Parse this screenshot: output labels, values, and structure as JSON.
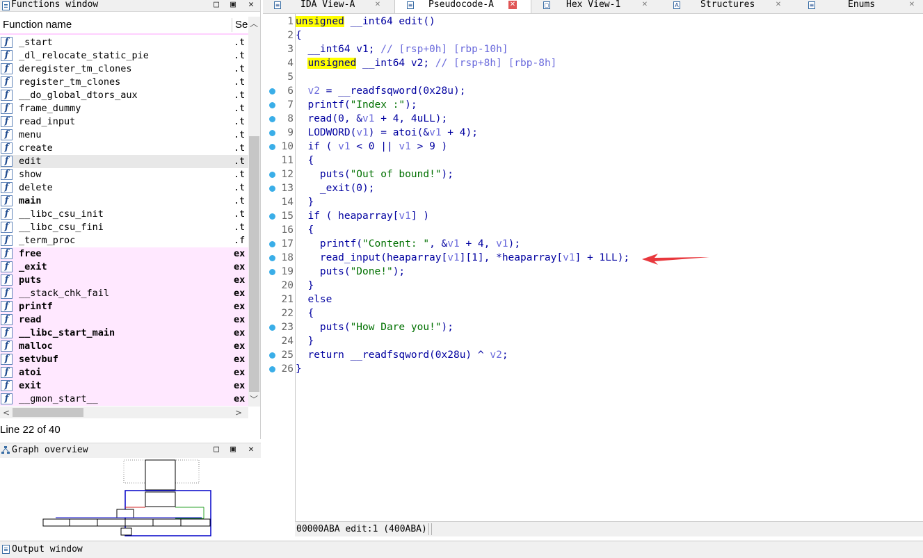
{
  "functions_window": {
    "title": "Functions window",
    "header_name": "Function name",
    "header_segment": "Se",
    "status": "Line 22 of 40",
    "rows": [
      {
        "name": "_start",
        "seg": ".t",
        "imported": false
      },
      {
        "name": "_dl_relocate_static_pie",
        "seg": ".t",
        "imported": false
      },
      {
        "name": "deregister_tm_clones",
        "seg": ".t",
        "imported": false
      },
      {
        "name": "register_tm_clones",
        "seg": ".t",
        "imported": false
      },
      {
        "name": "__do_global_dtors_aux",
        "seg": ".t",
        "imported": false
      },
      {
        "name": "frame_dummy",
        "seg": ".t",
        "imported": false
      },
      {
        "name": "read_input",
        "seg": ".t",
        "imported": false
      },
      {
        "name": "menu",
        "seg": ".t",
        "imported": false
      },
      {
        "name": "create",
        "seg": ".t",
        "imported": false
      },
      {
        "name": "edit",
        "seg": ".t",
        "imported": false,
        "selected": true
      },
      {
        "name": "show",
        "seg": ".t",
        "imported": false
      },
      {
        "name": "delete",
        "seg": ".t",
        "imported": false
      },
      {
        "name": "main",
        "seg": ".t",
        "imported": false,
        "bold": true
      },
      {
        "name": "__libc_csu_init",
        "seg": ".t",
        "imported": false
      },
      {
        "name": "__libc_csu_fini",
        "seg": ".t",
        "imported": false
      },
      {
        "name": "_term_proc",
        "seg": ".f",
        "imported": false
      },
      {
        "name": "free",
        "seg": "ex",
        "imported": true
      },
      {
        "name": "_exit",
        "seg": "ex",
        "imported": true
      },
      {
        "name": "puts",
        "seg": "ex",
        "imported": true
      },
      {
        "name": "__stack_chk_fail",
        "seg": "ex",
        "imported": true,
        "normal": true
      },
      {
        "name": "printf",
        "seg": "ex",
        "imported": true
      },
      {
        "name": "read",
        "seg": "ex",
        "imported": true
      },
      {
        "name": "__libc_start_main",
        "seg": "ex",
        "imported": true
      },
      {
        "name": "malloc",
        "seg": "ex",
        "imported": true
      },
      {
        "name": "setvbuf",
        "seg": "ex",
        "imported": true
      },
      {
        "name": "atoi",
        "seg": "ex",
        "imported": true
      },
      {
        "name": "exit",
        "seg": "ex",
        "imported": true
      },
      {
        "name": "__gmon_start__",
        "seg": "ex",
        "imported": true,
        "normal": true
      }
    ]
  },
  "graph_overview": {
    "title": "Graph overview"
  },
  "tabs": [
    {
      "label": "IDA View-A",
      "icon": "ida-view-icon",
      "active": false
    },
    {
      "label": "Pseudocode-A",
      "icon": "pseudocode-icon",
      "active": true
    },
    {
      "label": "Hex View-1",
      "icon": "hex-view-icon",
      "active": false
    },
    {
      "label": "Structures",
      "icon": "structures-icon",
      "active": false
    },
    {
      "label": "Enums",
      "icon": "enums-icon",
      "active": false
    }
  ],
  "pseudocode": {
    "lines": [
      {
        "n": "1",
        "dot": false,
        "html": "<span class='kwhl'>unsigned</span> __int64 edit()"
      },
      {
        "n": "2",
        "dot": false,
        "html": "{"
      },
      {
        "n": "3",
        "dot": false,
        "html": "  __int64 v1; <span class='cm'>// [rsp+0h] [rbp-10h]</span>"
      },
      {
        "n": "4",
        "dot": false,
        "html": "  <span class='kwhl'>unsigned</span> __int64 v2; <span class='cm'>// [rsp+8h] [rbp-8h]</span>"
      },
      {
        "n": "5",
        "dot": false,
        "html": ""
      },
      {
        "n": "6",
        "dot": true,
        "html": "  <span class='gv'>v2</span> = __readfsqword(0x28u);"
      },
      {
        "n": "7",
        "dot": true,
        "html": "  printf(<span class='str'>\"Index :\"</span>);"
      },
      {
        "n": "8",
        "dot": true,
        "html": "  read(0, &amp;<span class='gv'>v1</span> + 4, 4uLL);"
      },
      {
        "n": "9",
        "dot": true,
        "html": "  LODWORD(<span class='gv'>v1</span>) = atoi(&amp;<span class='gv'>v1</span> + 4);"
      },
      {
        "n": "10",
        "dot": true,
        "html": "  if ( <span class='gv'>v1</span> &lt; 0 || <span class='gv'>v1</span> &gt; 9 )"
      },
      {
        "n": "11",
        "dot": false,
        "html": "  {"
      },
      {
        "n": "12",
        "dot": true,
        "html": "    puts(<span class='str'>\"Out of bound!\"</span>);"
      },
      {
        "n": "13",
        "dot": true,
        "html": "    _exit(0);"
      },
      {
        "n": "14",
        "dot": false,
        "html": "  }"
      },
      {
        "n": "15",
        "dot": true,
        "html": "  if ( heaparray[<span class='gv'>v1</span>] )"
      },
      {
        "n": "16",
        "dot": false,
        "html": "  {"
      },
      {
        "n": "17",
        "dot": true,
        "html": "    printf(<span class='str'>\"Content: \"</span>, &amp;<span class='gv'>v1</span> + 4, <span class='gv'>v1</span>);"
      },
      {
        "n": "18",
        "dot": true,
        "html": "    read_input(heaparray[<span class='gv'>v1</span>][1], *heaparray[<span class='gv'>v1</span>] + 1LL);"
      },
      {
        "n": "19",
        "dot": true,
        "html": "    puts(<span class='str'>\"Done!\"</span>);"
      },
      {
        "n": "20",
        "dot": false,
        "html": "  }"
      },
      {
        "n": "21",
        "dot": false,
        "html": "  else"
      },
      {
        "n": "22",
        "dot": false,
        "html": "  {"
      },
      {
        "n": "23",
        "dot": true,
        "html": "    puts(<span class='str'>\"How Dare you!\"</span>);"
      },
      {
        "n": "24",
        "dot": false,
        "html": "  }"
      },
      {
        "n": "25",
        "dot": true,
        "html": "  return __readfsqword(0x28u) ^ <span class='gv'>v2</span>;"
      },
      {
        "n": "26",
        "dot": true,
        "html": "}"
      }
    ],
    "status": "00000ABA edit:1 (400ABA)"
  },
  "output_window": {
    "title": "Output window"
  },
  "colors": {
    "highlight": "#ffff00",
    "imported_row": "#ffe8ff",
    "breakpoint_dot": "#3aaee8",
    "annotation_arrow": "#e8383d"
  }
}
